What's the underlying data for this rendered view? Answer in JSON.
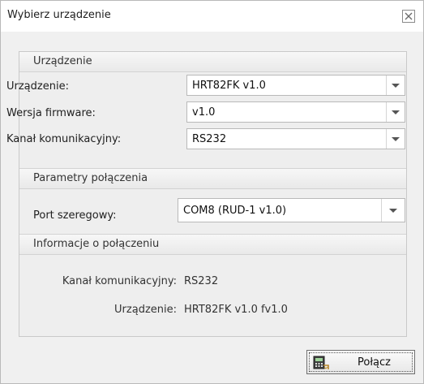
{
  "window": {
    "title": "Wybierz urządzenie"
  },
  "device_section": {
    "title": "Urządzenie",
    "fields": [
      {
        "label": "Urządzenie:",
        "value": "HRT82FK v1.0"
      },
      {
        "label": "Wersja firmware:",
        "value": "v1.0"
      },
      {
        "label": "Kanał komunikacyjny:",
        "value": "RS232"
      }
    ]
  },
  "connection_section": {
    "title": "Parametry połączenia",
    "port_label": "Port szeregowy:",
    "port_value": "COM8 (RUD-1 v1.0)"
  },
  "info_section": {
    "title": "Informacje o połączeniu",
    "channel_label": "Kanał komunikacyjny:",
    "channel_value": "RS232",
    "device_label": "Urządzenie:",
    "device_value": "HRT82FK v1.0 fv1.0"
  },
  "buttons": {
    "connect_label": "Połącz"
  }
}
